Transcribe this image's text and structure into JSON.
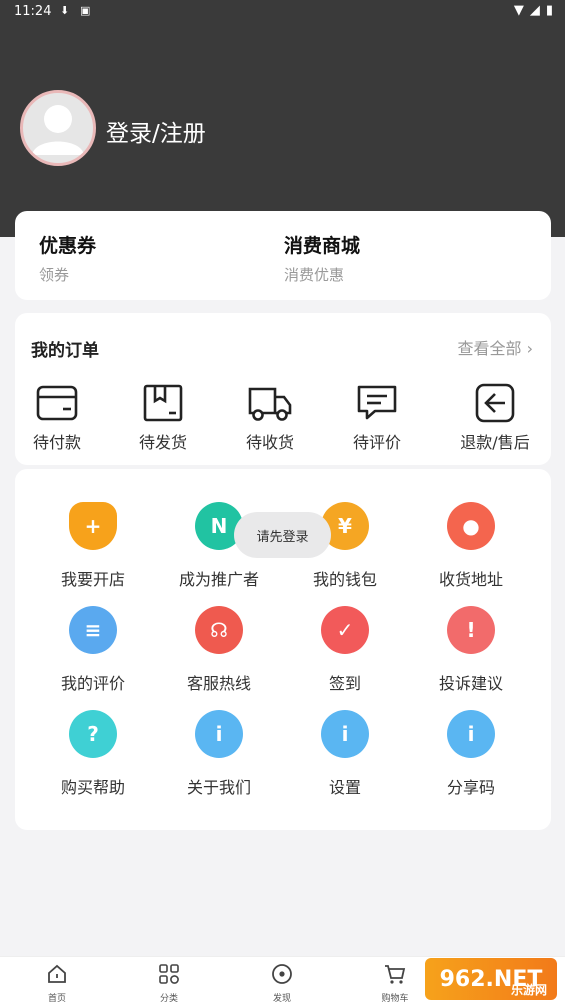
{
  "status_bar": {
    "time": "11:24"
  },
  "profile": {
    "login_text": "登录/注册"
  },
  "quick_links": [
    {
      "title": "优惠券",
      "subtitle": "领券"
    },
    {
      "title": "消费商城",
      "subtitle": "消费优惠"
    }
  ],
  "orders": {
    "title": "我的订单",
    "view_all": "查看全部",
    "items": [
      {
        "label": "待付款",
        "icon": "wallet-icon"
      },
      {
        "label": "待发货",
        "icon": "box-icon"
      },
      {
        "label": "待收货",
        "icon": "truck-icon"
      },
      {
        "label": "待评价",
        "icon": "comment-icon"
      },
      {
        "label": "退款/售后",
        "icon": "return-icon"
      }
    ]
  },
  "services": [
    {
      "label": "我要开店",
      "icon": "shop-icon",
      "color": "#f7a21b"
    },
    {
      "label": "成为推广者",
      "icon": "promoter-icon",
      "color": "#21c3a2"
    },
    {
      "label": "我的钱包",
      "icon": "wallet-coin-icon",
      "color": "#f5a623"
    },
    {
      "label": "收货地址",
      "icon": "location-icon",
      "color": "#f4654e"
    },
    {
      "label": "我的评价",
      "icon": "document-icon",
      "color": "#5aa9ef"
    },
    {
      "label": "客服热线",
      "icon": "headset-icon",
      "color": "#ef5a4f"
    },
    {
      "label": "签到",
      "icon": "calendar-check-icon",
      "color": "#f25a5a"
    },
    {
      "label": "投诉建议",
      "icon": "warning-icon",
      "color": "#f26b6b"
    },
    {
      "label": "购买帮助",
      "icon": "help-icon",
      "color": "#3fd0d4"
    },
    {
      "label": "关于我们",
      "icon": "info-icon",
      "color": "#5ab6f2"
    },
    {
      "label": "设置",
      "icon": "info-icon",
      "color": "#5ab6f2"
    },
    {
      "label": "分享码",
      "icon": "info-icon",
      "color": "#5ab6f2"
    }
  ],
  "toast": "请先登录",
  "tabbar": [
    {
      "label": "首页",
      "icon": "home-icon"
    },
    {
      "label": "分类",
      "icon": "category-icon"
    },
    {
      "label": "发现",
      "icon": "discover-icon"
    },
    {
      "label": "购物车",
      "icon": "cart-icon"
    }
  ],
  "watermark": {
    "text": "962.NET",
    "sub": "乐游网"
  }
}
